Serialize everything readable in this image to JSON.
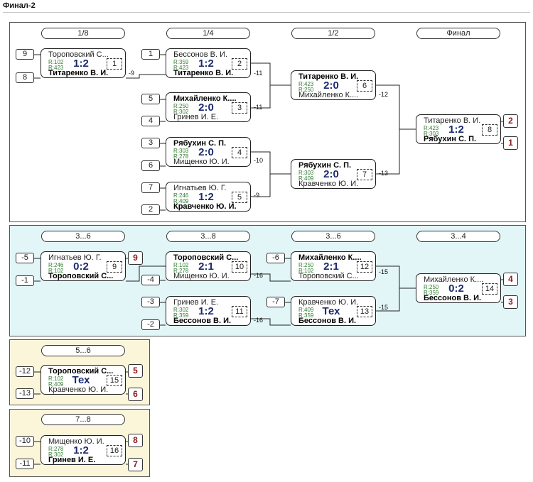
{
  "page_title": "Финал-2",
  "sections": [
    {
      "headers": [
        "1/8",
        "1/4",
        "1/2",
        "Финал"
      ],
      "seeds": [
        "9",
        "8",
        "1",
        "5",
        "4",
        "3",
        "6",
        "7",
        "2"
      ],
      "places": [
        "2",
        "1"
      ],
      "matches": [
        {
          "p1": "Тороповский С...",
          "p2": "Титаренко В. И.",
          "r1": "R:102",
          "r2": "R:423",
          "score": "1:2",
          "num": "1"
        },
        {
          "p1": "Бессонов В. И.",
          "p2": "Титаренко В. И.",
          "r1": "R:359",
          "r2": "R:423",
          "score": "1:2",
          "num": "2"
        },
        {
          "p1": "Михайленко К....",
          "p2": "Гринев И. Е.",
          "r1": "R:250",
          "r2": "R:302",
          "score": "2:0",
          "num": "3"
        },
        {
          "p1": "Рябухин С. П.",
          "p2": "Мищенко Ю. И.",
          "r1": "R:303",
          "r2": "R:278",
          "score": "2:0",
          "num": "4"
        },
        {
          "p1": "Игнатьев Ю. Г.",
          "p2": "Кравченко Ю. И.",
          "r1": "R:246",
          "r2": "R:409",
          "score": "1:2",
          "num": "5"
        },
        {
          "p1": "Титаренко В. И.",
          "p2": "Михайленко К....",
          "r1": "R:423",
          "r2": "R:250",
          "score": "2:0",
          "num": "6"
        },
        {
          "p1": "Рябухин С. П.",
          "p2": "Кравченко Ю. И.",
          "r1": "R:303",
          "r2": "R:409",
          "score": "2:0",
          "num": "7"
        },
        {
          "p1": "Титаренко В. И.",
          "p2": "Рябухин С. П.",
          "r1": "R:423",
          "r2": "R:303",
          "score": "1:2",
          "num": "8"
        }
      ],
      "labels": [
        "-9",
        "-11",
        "-11",
        "-10",
        "-9",
        "-12",
        "-13"
      ]
    },
    {
      "headers": [
        "3...6",
        "3...8",
        "3...6",
        "3...4"
      ],
      "seeds": [
        "-5",
        "-1",
        "-4",
        "-3",
        "-2",
        "-6",
        "-7"
      ],
      "places": [
        "9",
        "4",
        "3"
      ],
      "matches": [
        {
          "p1": "Игнатьев Ю. Г.",
          "p2": "Тороповский С...",
          "r1": "R:246",
          "r2": "R:102",
          "score": "0:2",
          "num": "9"
        },
        {
          "p1": "Тороповский С...",
          "p2": "Мищенко Ю. И.",
          "r1": "R:102",
          "r2": "R:278",
          "score": "2:1",
          "num": "10"
        },
        {
          "p1": "Гринев И. Е.",
          "p2": "Бессонов В. И.",
          "r1": "R:302",
          "r2": "R:359",
          "score": "1:2",
          "num": "11"
        },
        {
          "p1": "Михайленко К....",
          "p2": "Тороповский С...",
          "r1": "R:250",
          "r2": "R:102",
          "score": "2:1",
          "num": "12"
        },
        {
          "p1": "Кравченко Ю. И.",
          "p2": "Бессонов В. И.",
          "r1": "R:409",
          "r2": "R:359",
          "score": "Тех",
          "num": "13"
        },
        {
          "p1": "Михайленко К....",
          "p2": "Бессонов В. И.",
          "r1": "R:250",
          "r2": "R:359",
          "score": "0:2",
          "num": "14"
        }
      ],
      "labels": [
        "-16",
        "-16",
        "-15",
        "-15"
      ]
    },
    {
      "headers": [
        "5...6"
      ],
      "seeds": [
        "-12",
        "-13"
      ],
      "places": [
        "5",
        "6"
      ],
      "matches": [
        {
          "p1": "Тороповский С...",
          "p2": "Кравченко Ю. И.",
          "r1": "R:102",
          "r2": "R:409",
          "score": "Тех",
          "num": "15"
        }
      ]
    },
    {
      "headers": [
        "7...8"
      ],
      "seeds": [
        "-10",
        "-11"
      ],
      "places": [
        "8",
        "7"
      ],
      "matches": [
        {
          "p1": "Мищенко Ю. И.",
          "p2": "Гринев И. Е.",
          "r1": "R:278",
          "r2": "R:302",
          "score": "1:2",
          "num": "16"
        }
      ]
    }
  ]
}
